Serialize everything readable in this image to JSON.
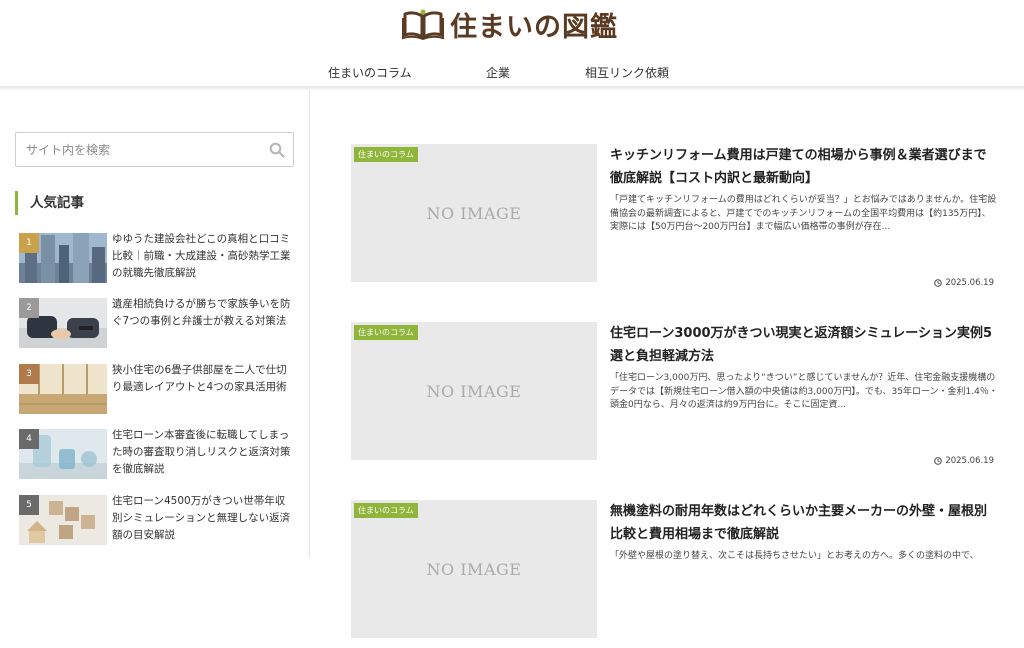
{
  "site": {
    "logo_text": "住まいの図鑑",
    "logo_icon": "open-book-icon",
    "brand_color": "#5a3a22",
    "accent_color": "#8fb53a"
  },
  "nav": {
    "items": [
      {
        "label": "住まいのコラム"
      },
      {
        "label": "企業"
      },
      {
        "label": "相互リンク依頼"
      }
    ]
  },
  "sidebar": {
    "search_placeholder": "サイト内を検索",
    "search_icon": "search-icon",
    "popular_title": "人気記事",
    "popular": [
      {
        "rank": "1",
        "title": "ゆゆうた建設会社どこの真相と口コミ比較｜前職・大成建設・高砂熱学工業の就職先徹底解説",
        "badge_color": "#c9a24b"
      },
      {
        "rank": "2",
        "title": "遺産相続負けるが勝ちで家族争いを防ぐ7つの事例と弁護士が教える対策法",
        "badge_color": "#9a9a9a"
      },
      {
        "rank": "3",
        "title": "狭小住宅の6畳子供部屋を二人で仕切り最適レイアウトと4つの家具活用術",
        "badge_color": "#b07a4a"
      },
      {
        "rank": "4",
        "title": "住宅ローン本審査後に転職してしまった時の審査取り消しリスクと返済対策を徹底解説",
        "badge_color": "#6a6a6a"
      },
      {
        "rank": "5",
        "title": "住宅ローン4500万がきつい世帯年収別シミュレーションと無理しない返済額の目安解説",
        "badge_color": "#6a6a6a"
      }
    ]
  },
  "main": {
    "articles": [
      {
        "category": "住まいのコラム",
        "thumb_text": "NO IMAGE",
        "title": "キッチンリフォーム費用は戸建ての相場から事例＆業者選びまで徹底解説【コスト内訳と最新動向】",
        "excerpt": "「戸建てキッチンリフォームの費用はどれくらいが妥当？」とお悩みではありませんか。住宅設備協会の最新調査によると、戸建てでのキッチンリフォームの全国平均費用は【約135万円】、実際には【50万円台～200万円台】まで幅広い価格帯の事例が存在...",
        "date": "2025.06.19"
      },
      {
        "category": "住まいのコラム",
        "thumb_text": "NO IMAGE",
        "title": "住宅ローン3000万がきつい現実と返済額シミュレーション実例5選と負担軽減方法",
        "excerpt": "「住宅ローン3,000万円、思ったより“きつい”と感じていませんか？近年、住宅金融支援機構のデータでは【新規住宅ローン借入額の中央値は約3,000万円】。でも、35年ローン・金利1.4％・頭金0円なら、月々の返済は約9万円台に。そこに固定資...",
        "date": "2025.06.19"
      },
      {
        "category": "住まいのコラム",
        "thumb_text": "NO IMAGE",
        "title": "無機塗料の耐用年数はどれくらいか主要メーカーの外壁・屋根別比較と費用相場まで徹底解説",
        "excerpt": "「外壁や屋根の塗り替え、次こそは長持ちさせたい」とお考えの方へ。多くの塗料の中で、",
        "date": ""
      }
    ]
  }
}
